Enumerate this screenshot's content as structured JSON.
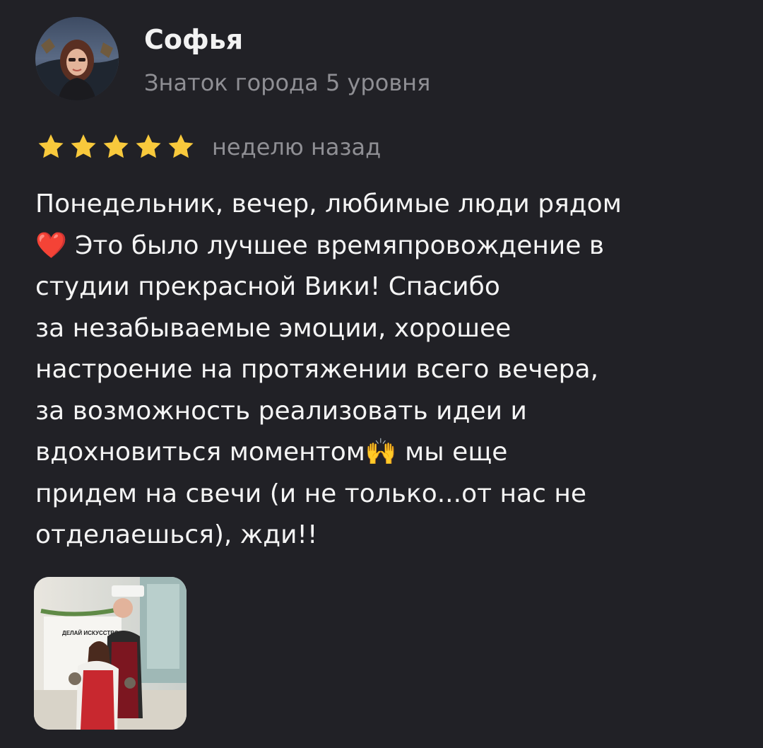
{
  "review": {
    "author": {
      "name": "Софья",
      "level": "Знаток города 5 уровня",
      "avatar_icon": "user-avatar-photo"
    },
    "rating": {
      "stars": 5,
      "max": 5,
      "star_color": "#f8c93c",
      "date": "неделю назад"
    },
    "text": "Понедельник, вечер, любимые люди рядом\n❤️ Это было лучшее времяпровождение в\n студии прекрасной Вики! Спасибо\nза незабываемые эмоции, хорошее\nнастроение на протяжении всего вечера,\nза возможность реализовать идеи и\nвдохновиться моментом🙌 мы еще\nпридем на свечи (и не только...от нас не\nотделаешься), жди!!",
    "photos": [
      {
        "icon": "review-photo",
        "sign_text": "ДЕЛАЙ ИСКУССТВО"
      }
    ]
  },
  "colors": {
    "background": "#212126",
    "text": "#f4f4f4",
    "secondary_text": "#8f8f94"
  }
}
